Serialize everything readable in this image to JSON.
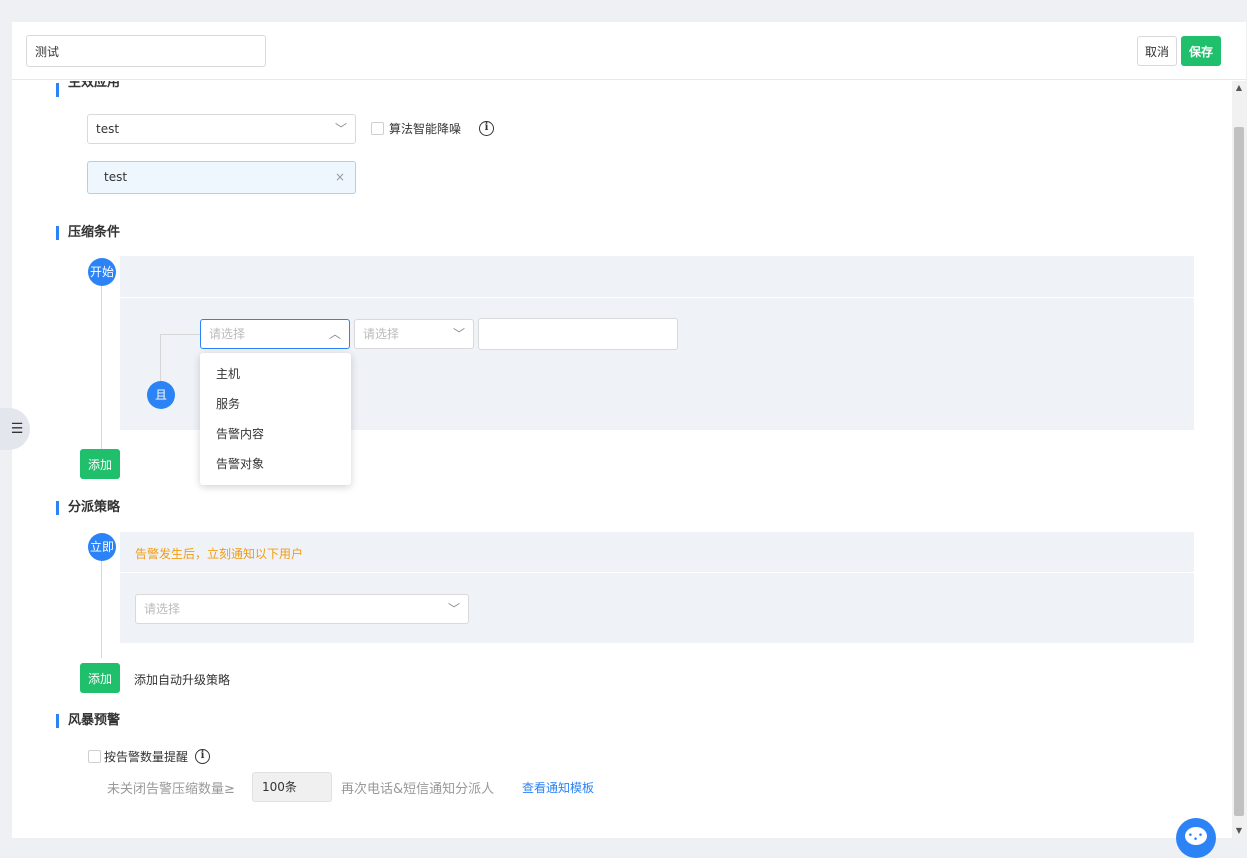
{
  "header": {
    "name_value": "测试",
    "cancel_label": "取消",
    "save_label": "保存"
  },
  "sections": {
    "app": {
      "title": "生效应用",
      "app_select_value": "test",
      "noise_checkbox_label": "算法智能降噪",
      "info_icon": "info-circle-icon",
      "selected_tag": "test",
      "tag_close": "×"
    },
    "compress": {
      "title": "压缩条件",
      "start_label": "开始",
      "and_label": "且",
      "field_select_placeholder": "请选择",
      "operator_select_placeholder": "请选择",
      "value_input": "",
      "add_label": "添加",
      "dropdown_options": [
        "主机",
        "服务",
        "告警内容",
        "告警对象"
      ]
    },
    "dispatch": {
      "title": "分派策略",
      "immediate_label": "立即",
      "notice": "告警发生后，立刻通知以下用户",
      "user_select_placeholder": "请选择",
      "add_label": "添加",
      "upgrade_text": "添加自动升级策略"
    },
    "storm": {
      "title": "风暴预警",
      "checkbox_label": "按告警数量提醒",
      "condition_prefix": "未关闭告警压缩数量≥",
      "count_value": "100条",
      "condition_suffix": "再次电话&短信通知分派人",
      "template_link": "查看通知模板"
    }
  },
  "colors": {
    "primary": "#2b83f6",
    "success": "#1fbf6c",
    "warning_text": "#f39c12",
    "panel_bg": "#eff2f7"
  }
}
